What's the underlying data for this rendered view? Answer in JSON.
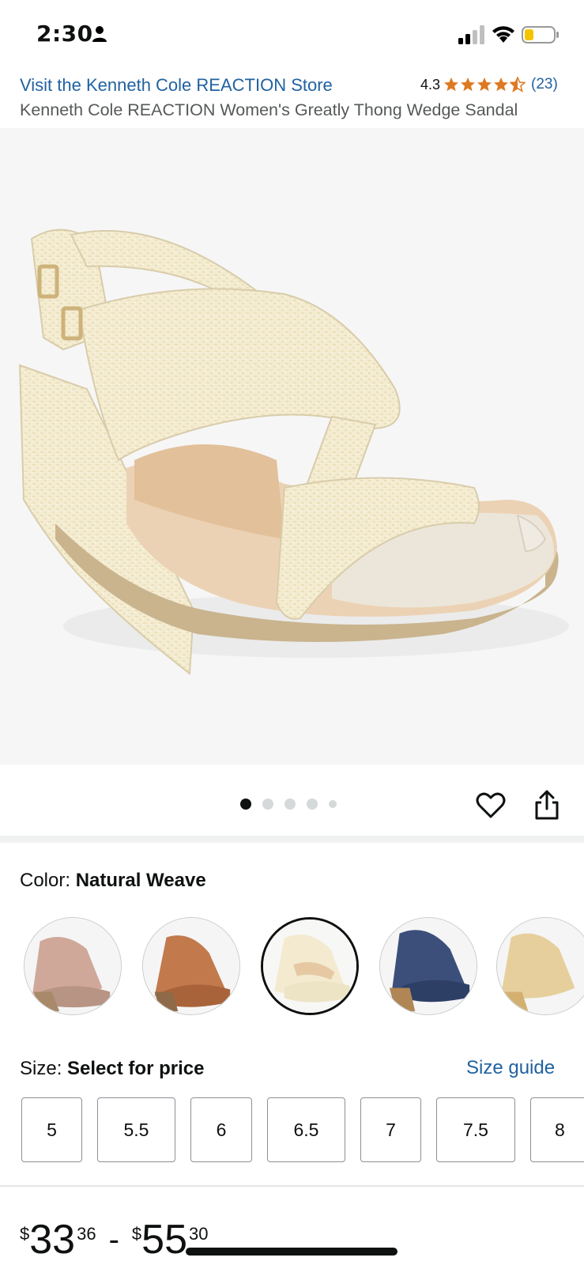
{
  "status_bar": {
    "time": "2:30",
    "icons": [
      "person-icon",
      "signal-icon",
      "wifi-icon",
      "battery-icon"
    ]
  },
  "header": {
    "store_link": "Visit the Kenneth Cole REACTION Store",
    "rating": "4.3",
    "stars": 4.3,
    "rating_count": "(23)",
    "title": "Kenneth Cole REACTION Women's Greatly Thong Wedge Sandal"
  },
  "gallery": {
    "image_count": 5,
    "active_index": 0
  },
  "color": {
    "label": "Color:",
    "value": "Natural Weave",
    "swatches": [
      {
        "name": "taupe",
        "color": "#cfa89a"
      },
      {
        "name": "cognac",
        "color": "#c27a4c"
      },
      {
        "name": "natural-weave",
        "color": "#f3ead0",
        "selected": true
      },
      {
        "name": "navy",
        "color": "#3b4f7a"
      },
      {
        "name": "gold",
        "color": "#e6cf9c"
      }
    ]
  },
  "size": {
    "label": "Size:",
    "value": "Select for price",
    "guide_link": "Size guide",
    "options": [
      "5",
      "5.5",
      "6",
      "6.5",
      "7",
      "7.5",
      "8"
    ]
  },
  "price": {
    "low_currency": "$",
    "low_whole": "33",
    "low_fraction": "36",
    "separator": "-",
    "high_currency": "$",
    "high_whole": "55",
    "high_fraction": "30"
  },
  "colors": {
    "link": "#2162a1",
    "star": "#de7921",
    "text": "#0f1111",
    "secondary_text": "#565959"
  }
}
